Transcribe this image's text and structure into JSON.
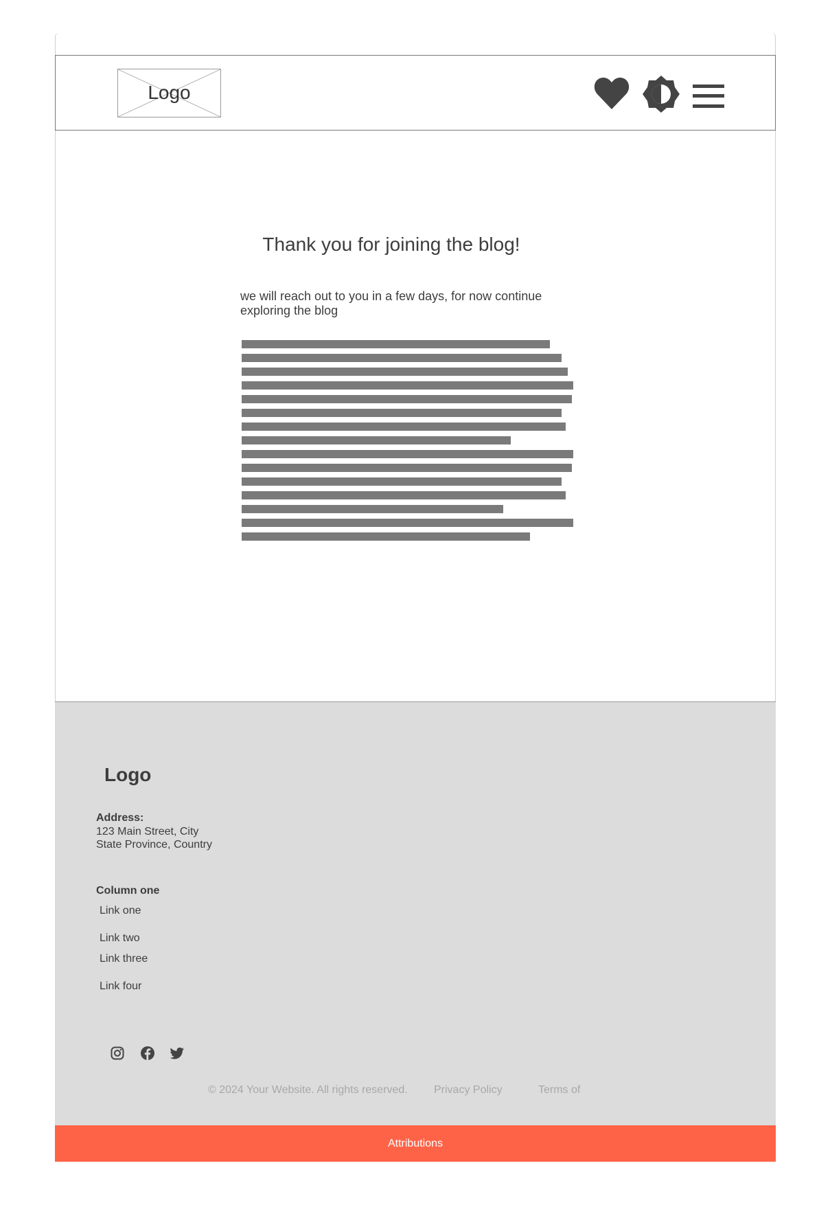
{
  "header": {
    "logo_label": "Logo",
    "icons": [
      "heart-icon",
      "brightness-icon",
      "hamburger-menu-icon"
    ]
  },
  "main": {
    "title": "Thank you for joining the blog!",
    "subtitle": "we will reach out to you in a few days, for now continue exploring the blog"
  },
  "footer": {
    "logo_label": "Logo",
    "address_label": "Address:",
    "address_line1": "123 Main Street, City",
    "address_line2": "State Province, Country",
    "column_title": "Column one",
    "links": [
      "Link one",
      "Link two",
      "Link three",
      "Link four"
    ],
    "social_icons": [
      "instagram-icon",
      "facebook-icon",
      "twitter-icon"
    ],
    "copyright": "© 2024 Your Website. All rights reserved.",
    "privacy": "Privacy Policy",
    "terms": "Terms of"
  },
  "attribution_bar": {
    "label": "Attributions",
    "color": "#ff6347"
  },
  "colors": {
    "icon": "#444444",
    "placeholder_lines": "#7a7a7a",
    "footer_bg": "#dcdcdc"
  }
}
